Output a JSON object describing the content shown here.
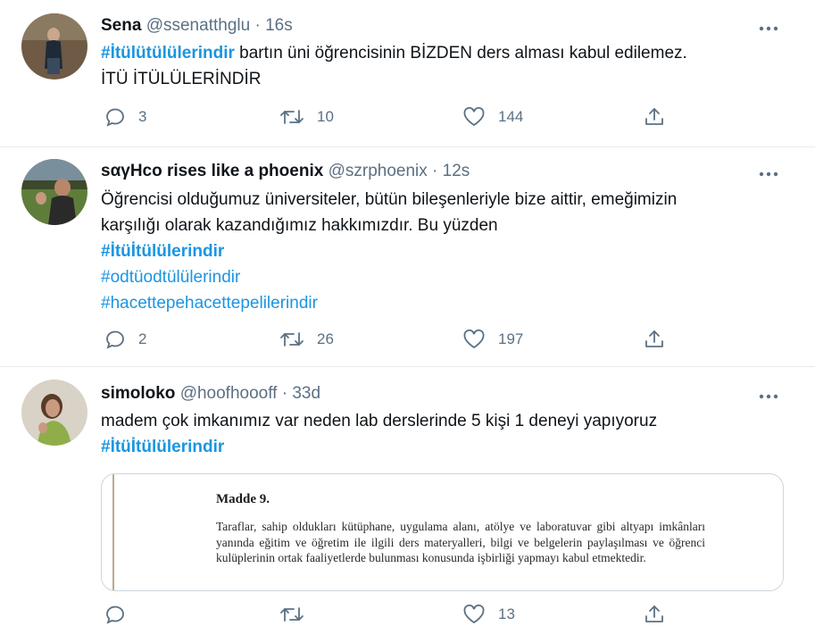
{
  "tweets": [
    {
      "display_name": "Sena",
      "handle": "@ssenatthglu",
      "separator": "·",
      "time": "16s",
      "text_parts": [
        {
          "text": "#İtülütülülerindir",
          "style": "tag-bold"
        },
        {
          "text": " bartın üni öğrencisinin BİZDEN ders alması kabul edilemez.",
          "style": "plain"
        }
      ],
      "text_line2": "İTÜ İTÜLÜLERİNDİR",
      "replies": "3",
      "retweets": "10",
      "likes": "144"
    },
    {
      "display_name": "sαγΗco rises like a phoenix",
      "handle": "@szrphoenix",
      "separator": "·",
      "time": "12s",
      "text_line1": "Öğrencisi olduğumuz üniversiteler, bütün bileşenleriyle bize aittir, emeğimizin",
      "text_line2": "karşılığı olarak kazandığımız hakkımızdır. Bu yüzden",
      "hashtags": [
        "#İtüİtülülerindir",
        "#odtüodtülülerindir",
        "#hacettepehacettepelilerindir"
      ],
      "replies": "2",
      "retweets": "26",
      "likes": "197"
    },
    {
      "display_name": "simoloko",
      "handle": "@hoofhoooff",
      "separator": "·",
      "time": "33d",
      "text_line1": "madem çok imkanımız var neden lab derslerinde 5 kişi 1 deneyi yapıyoruz",
      "hashtag": "#İtüİtülülerindir",
      "media_title": "Madde 9.",
      "media_text": "Taraflar, sahip oldukları kütüphane, uygulama alanı, atölye ve laboratuvar gibi altyapı imkânları yanında eğitim ve öğretim ile ilgili ders materyalleri, bilgi ve belgelerin paylaşılması ve öğrenci kulüplerinin ortak faaliyetlerde bulunması konusunda işbirliği yapmayı kabul etmektedir.",
      "replies": "",
      "retweets": "",
      "likes": "13"
    }
  ],
  "icons": {
    "reply": "reply-icon",
    "retweet": "retweet-icon",
    "like": "like-icon",
    "share": "share-icon",
    "more": "more-icon"
  },
  "colors": {
    "link": "#1b95e0",
    "muted": "#5b7083",
    "divider": "#e6ecf0"
  }
}
